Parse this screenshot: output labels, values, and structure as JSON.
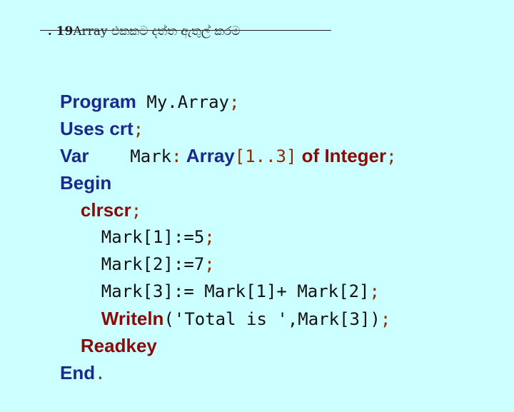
{
  "slide": {
    "title_number": ". 19",
    "title_text": "Array එකකට දත්ත ඇතුල් කරම"
  },
  "code": {
    "l1_kw": "Program",
    "l1_name": " My.Array",
    "l1_end": ";",
    "l2_kw": "Uses",
    "l2_name": " crt",
    "l2_end": ";",
    "l3_kw": "Var",
    "l3_mono": "    Mark",
    "l3_colon": ":",
    "l3_array": " Array",
    "l3_range": "[1..3]",
    "l3_of": " of Integer",
    "l3_end": ";",
    "l4_kw": "Begin",
    "l5_indent": "  ",
    "l5_kw": "clrscr",
    "l5_end": ";",
    "l6_text": "    Mark[1]:=5",
    "l6_end": ";",
    "l7_text": "    Mark[2]:=7",
    "l7_end": ";",
    "l8_text": "    Mark[3]:= Mark[1]+ Mark[2]",
    "l8_end": ";",
    "l9_indent": "    ",
    "l9_kw": "Writeln",
    "l9_args": "('Total is ',Mark[3])",
    "l9_end": ";",
    "l10_indent": "  ",
    "l10_kw": "Readkey",
    "l11_kw": "End",
    "l11_end": "."
  }
}
